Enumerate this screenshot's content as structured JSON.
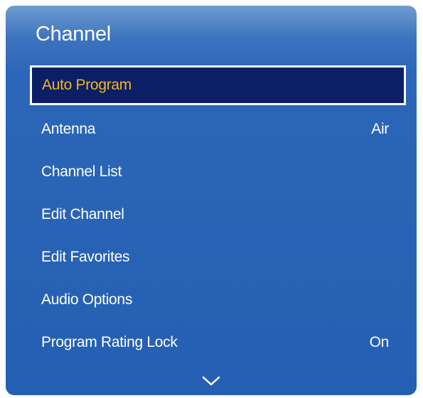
{
  "menu": {
    "title": "Channel",
    "items": [
      {
        "label": "Auto Program",
        "value": "",
        "selected": true
      },
      {
        "label": "Antenna",
        "value": "Air"
      },
      {
        "label": "Channel List",
        "value": ""
      },
      {
        "label": "Edit Channel",
        "value": ""
      },
      {
        "label": "Edit Favorites",
        "value": ""
      },
      {
        "label": "Audio Options",
        "value": ""
      },
      {
        "label": "Program Rating Lock",
        "value": "On"
      }
    ]
  },
  "colors": {
    "panel_top": "#6f9bd0",
    "panel_body": "#255fb3",
    "selected_bg": "#0a1f66",
    "selected_text": "#f5b81a",
    "text": "#ffffff"
  },
  "icons": {
    "scroll_indicator": "chevron-down-icon"
  }
}
